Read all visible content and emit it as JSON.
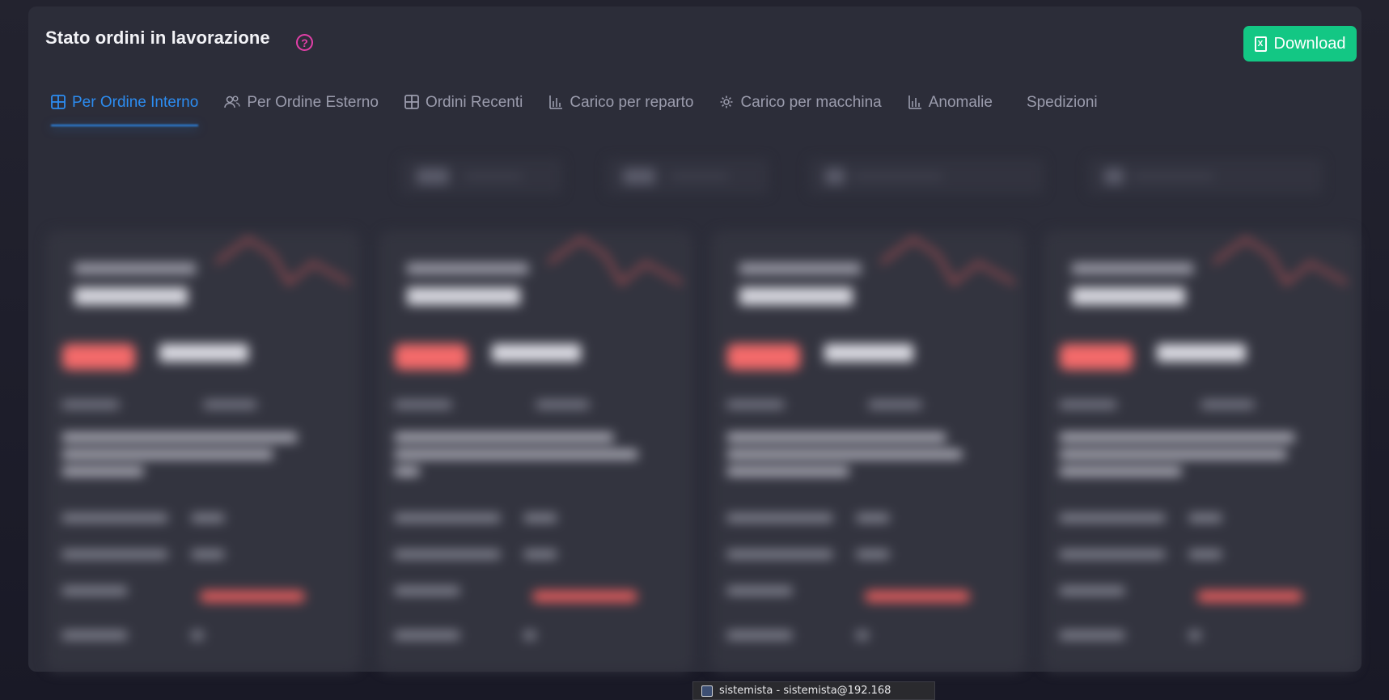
{
  "header": {
    "title": "Stato ordini in lavorazione",
    "help_icon": "question-circle-icon",
    "download_label": "Download"
  },
  "tabs": [
    {
      "label": "Per Ordine Interno",
      "icon": "grid-icon",
      "active": true
    },
    {
      "label": "Per Ordine Esterno",
      "icon": "users-icon",
      "active": false
    },
    {
      "label": "Ordini Recenti",
      "icon": "grid-icon",
      "active": false
    },
    {
      "label": "Carico per reparto",
      "icon": "bar-chart-icon",
      "active": false
    },
    {
      "label": "Carico per macchina",
      "icon": "gear-icon",
      "active": false
    },
    {
      "label": "Anomalie",
      "icon": "bar-chart-icon",
      "active": false
    },
    {
      "label": "Spedizioni",
      "icon": "",
      "active": false
    }
  ],
  "taskbar_tooltip": {
    "text": "sistemista - sistemista@192.168"
  },
  "colors": {
    "accent_active_tab": "#2c8cf0",
    "download_button": "#13c784",
    "help_icon": "#e23fa8",
    "badge_red": "#f36a6a"
  }
}
